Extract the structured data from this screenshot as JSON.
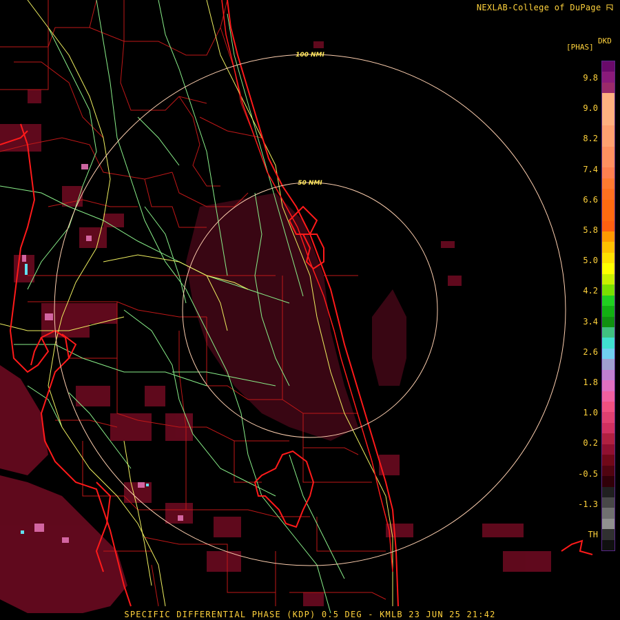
{
  "header": {
    "credit": "NEXLAB-College of DuPage",
    "credit_icon": "college-logo-icon"
  },
  "legend": {
    "code": "DKD",
    "units": "[PHAS]",
    "ticks": [
      "9.8",
      "9.0",
      "8.2",
      "7.4",
      "6.6",
      "5.8",
      "5.0",
      "4.2",
      "3.4",
      "2.6",
      "1.8",
      "1.0",
      "0.2",
      "-0.5",
      "-1.3",
      "TH"
    ],
    "colors": [
      "#6a0a6a",
      "#8a1a7a",
      "#9a2a6a",
      "#ffb080",
      "#ffb080",
      "#ffb080",
      "#ffa070",
      "#ffa070",
      "#ff9060",
      "#ff9060",
      "#ff8050",
      "#ff7a30",
      "#ff7020",
      "#ff6a10",
      "#ff6a10",
      "#ff6010",
      "#ff9a00",
      "#ffc000",
      "#ffe000",
      "#ffff00",
      "#c8f000",
      "#7ae000",
      "#20d020",
      "#12b012",
      "#109010",
      "#40c080",
      "#40e0d0",
      "#70d0f0",
      "#a0a0d0",
      "#c080d0",
      "#e070c0",
      "#f060a0",
      "#f05080",
      "#e04070",
      "#d03060",
      "#b02040",
      "#901030",
      "#700818",
      "#500410",
      "#300008",
      "#202020",
      "#484848",
      "#707070",
      "#909090",
      "#303030",
      "#101010"
    ]
  },
  "footer": {
    "caption": "SPECIFIC DIFFERENTIAL PHASE (KDP) 0.5 DEG - KMLB 23 JUN 25 21:42"
  },
  "map": {
    "range_rings": [
      {
        "label": "50 NMI"
      },
      {
        "label": "100 NMI"
      }
    ],
    "colors": {
      "coastline": "#ff1a1a",
      "county_border": "#c01818",
      "state_road": "#8af08a",
      "interstate": "#f0f060",
      "range_ring": "#ffd0b0",
      "echo_light": "#6a0a20",
      "echo_mid": "#8a1030",
      "echo_heavy": "#a01a3a",
      "echo_pink": "#e070b0",
      "echo_cyan": "#60e0f0"
    }
  }
}
